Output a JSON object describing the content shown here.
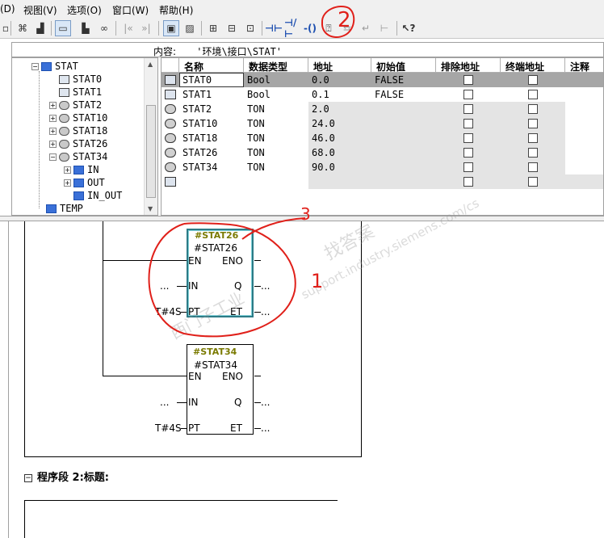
{
  "menu": [
    "(D)",
    "视图(V)",
    "选项(O)",
    "窗口(W)",
    "帮助(H)"
  ],
  "content_path": {
    "label": "内容:",
    "value": " '环境\\接口\\STAT'"
  },
  "tree": [
    {
      "label": "STAT",
      "icon": "block-icon",
      "expander": "−"
    },
    {
      "label": "STAT0",
      "icon": "variable-icon",
      "expander": ""
    },
    {
      "label": "STAT1",
      "icon": "variable-icon",
      "expander": ""
    },
    {
      "label": "STAT2",
      "icon": "timer-icon",
      "expander": "+"
    },
    {
      "label": "STAT10",
      "icon": "timer-icon",
      "expander": "+"
    },
    {
      "label": "STAT18",
      "icon": "timer-icon",
      "expander": "+"
    },
    {
      "label": "STAT26",
      "icon": "timer-icon",
      "expander": "+"
    },
    {
      "label": "STAT34",
      "icon": "timer-icon",
      "expander": "−"
    },
    {
      "label": "IN",
      "icon": "block-icon",
      "expander": "+"
    },
    {
      "label": "OUT",
      "icon": "block-icon",
      "expander": "+"
    },
    {
      "label": "IN_OUT",
      "icon": "block-icon",
      "expander": ""
    },
    {
      "label": "TEMP",
      "icon": "block-icon",
      "expander": ""
    }
  ],
  "table": {
    "columns": [
      "名称",
      "数据类型",
      "地址",
      "初始值",
      "排除地址",
      "终端地址",
      "注释"
    ],
    "rows": [
      {
        "name": "STAT0",
        "type": "Bool",
        "address": "0.0",
        "initial": "FALSE",
        "icon": "variable-icon"
      },
      {
        "name": "STAT1",
        "type": "Bool",
        "address": "0.1",
        "initial": "FALSE",
        "icon": "variable-icon"
      },
      {
        "name": "STAT2",
        "type": "TON",
        "address": "2.0",
        "initial": "",
        "icon": "timer-icon"
      },
      {
        "name": "STAT10",
        "type": "TON",
        "address": "24.0",
        "initial": "",
        "icon": "timer-icon"
      },
      {
        "name": "STAT18",
        "type": "TON",
        "address": "46.0",
        "initial": "",
        "icon": "timer-icon"
      },
      {
        "name": "STAT26",
        "type": "TON",
        "address": "68.0",
        "initial": "",
        "icon": "timer-icon"
      },
      {
        "name": "STAT34",
        "type": "TON",
        "address": "90.0",
        "initial": "",
        "icon": "timer-icon"
      },
      {
        "name": "",
        "type": "",
        "address": "",
        "initial": "",
        "icon": "variable-icon"
      }
    ]
  },
  "blocks": [
    {
      "instance": "#STAT26",
      "symbol": "#STAT26",
      "pins": {
        "en": "EN",
        "eno": "ENO",
        "in": "IN",
        "q": "Q",
        "pt": "PT",
        "et": "ET"
      },
      "in_value": "...",
      "pt_value": "T#4S",
      "q_value": "...",
      "et_value": "..."
    },
    {
      "instance": "#STAT34",
      "symbol": "#STAT34",
      "pins": {
        "en": "EN",
        "eno": "ENO",
        "in": "IN",
        "q": "Q",
        "pt": "PT",
        "et": "ET"
      },
      "in_value": "...",
      "pt_value": "T#4S",
      "q_value": "...",
      "et_value": "..."
    }
  ],
  "network": {
    "expander": "−",
    "title": "程序段 2:标题:"
  },
  "annotations": {
    "mark_1": "1",
    "mark_2": "2",
    "mark_3": "3"
  },
  "watermark": {
    "text_cn": "找答案",
    "text_en": "support.industry.siemens.com/cs",
    "text_cn2": "西门子工业"
  },
  "colors": {
    "selection_highlight": "#2c7b86",
    "annotation_red": "#e0201a",
    "instance_label": "#7a7a00"
  }
}
